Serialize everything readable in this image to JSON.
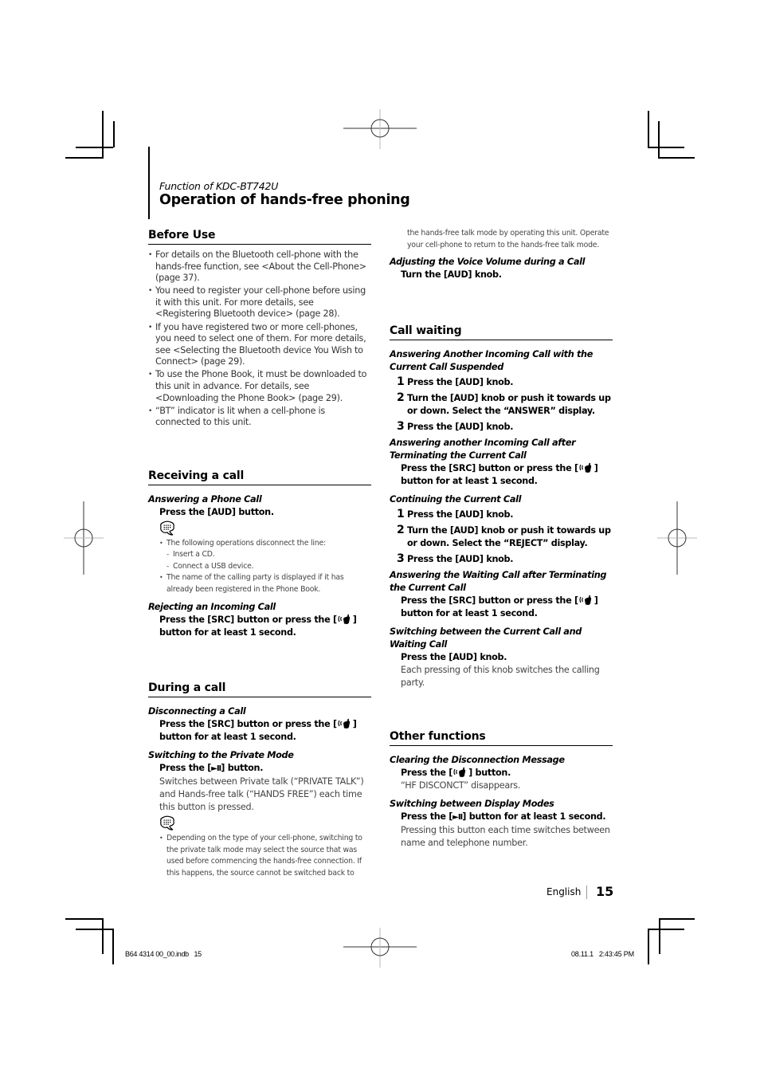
{
  "header": {
    "kicker": "Function of KDC-BT742U",
    "title": "Operation of hands-free phoning"
  },
  "icons": {
    "note": "note-speech-bubble-icon",
    "phone": "hands-free-phone-icon",
    "play_pause": "play-pause-icon"
  },
  "before_use": {
    "heading": "Before Use",
    "items": [
      "For details on the Bluetooth cell-phone with the hands-free function, see <About the Cell-Phone> (page 37).",
      "You need to register your cell-phone before using it with this unit. For more details, see <Registering Bluetooth device> (page 28).",
      "If you have registered two or more cell-phones, you need to select one of them. For more details, see <Selecting the Bluetooth device You Wish to Connect> (page 29).",
      "To use the Phone Book, it must be downloaded to this unit in advance. For details, see <Downloading the Phone Book> (page 29).",
      "“BT” indicator is lit when a cell-phone is connected to this unit."
    ]
  },
  "receiving": {
    "heading": "Receiving a call",
    "answering": {
      "title": "Answering a Phone Call",
      "instruction": "Press the [AUD] button.",
      "notes": [
        "The following operations disconnect the line:",
        "Insert a CD.",
        "Connect a USB device.",
        "The name of the calling party is displayed if it has already been registered in the Phone Book."
      ]
    },
    "rejecting": {
      "title": "Rejecting an Incoming Call",
      "instruction_a": "Press the [SRC] button or press the [",
      "instruction_b": "] button for at least 1 second."
    }
  },
  "during": {
    "heading": "During a call",
    "disconnecting": {
      "title": "Disconnecting a Call",
      "instruction_a": "Press the [SRC] button or press the [",
      "instruction_b": "] button for at least 1 second."
    },
    "private": {
      "title": "Switching to the Private Mode",
      "instruction_a": "Press the [",
      "play_pause_glyph": "►II",
      "instruction_b": "] button.",
      "description": "Switches between Private talk (“PRIVATE TALK”) and Hands-free talk (“HANDS FREE”) each time this button is pressed.",
      "note": "Depending on the type of your cell-phone, switching to the private talk mode may select the source that was used before commencing the hands-free connection. If this happens, the source cannot be switched back to",
      "note_continued": "the hands-free talk mode by operating this unit. Operate your cell-phone to return to the hands-free talk mode."
    },
    "volume": {
      "title": "Adjusting the Voice Volume during a Call",
      "instruction": "Turn the [AUD] knob."
    }
  },
  "call_waiting": {
    "heading": "Call waiting",
    "suspend": {
      "title": "Answering Another Incoming Call with the Current Call Suspended",
      "steps": [
        {
          "num": "1",
          "text": "Press the [AUD] knob."
        },
        {
          "num": "2",
          "text": "Turn the [AUD] knob or push it towards up or down. Select the “ANSWER” display."
        },
        {
          "num": "3",
          "text": "Press the [AUD] knob."
        }
      ]
    },
    "terminate": {
      "title": "Answering another Incoming Call after Terminating the Current Call",
      "instruction_a": "Press the [SRC] button or press the [",
      "instruction_b": "] button for at least 1 second."
    },
    "continuing": {
      "title": "Continuing the Current Call",
      "steps": [
        {
          "num": "1",
          "text": "Press the [AUD] knob."
        },
        {
          "num": "2",
          "text": "Turn the [AUD] knob or push it towards up or down. Select the “REJECT” display."
        },
        {
          "num": "3",
          "text": "Press the [AUD] knob."
        }
      ]
    },
    "waiting_after": {
      "title": "Answering the Waiting Call after Terminating the Current Call",
      "instruction_a": "Press the [SRC] button or press the [",
      "instruction_b": "] button for at least 1 second."
    },
    "switching": {
      "title": "Switching between the Current Call and Waiting Call",
      "instruction": "Press the [AUD] knob.",
      "description": "Each pressing of this knob switches the calling party."
    }
  },
  "other": {
    "heading": "Other functions",
    "clearing": {
      "title": "Clearing the Disconnection Message",
      "instruction_a": "Press the [",
      "instruction_b": "] button.",
      "description": "“HF DISCONCT” disappears."
    },
    "display": {
      "title": "Switching between Display Modes",
      "instruction_a": "Press the [",
      "play_pause_glyph": "►II",
      "instruction_b": "] button for at least 1 second.",
      "description": "Pressing this button each time switches between name and telephone number."
    }
  },
  "footer": {
    "language": "English",
    "page_number": "15",
    "slug_left": "B64 4314 00_00.indb   15",
    "slug_right": "08.11.1   2:43:45 PM"
  }
}
